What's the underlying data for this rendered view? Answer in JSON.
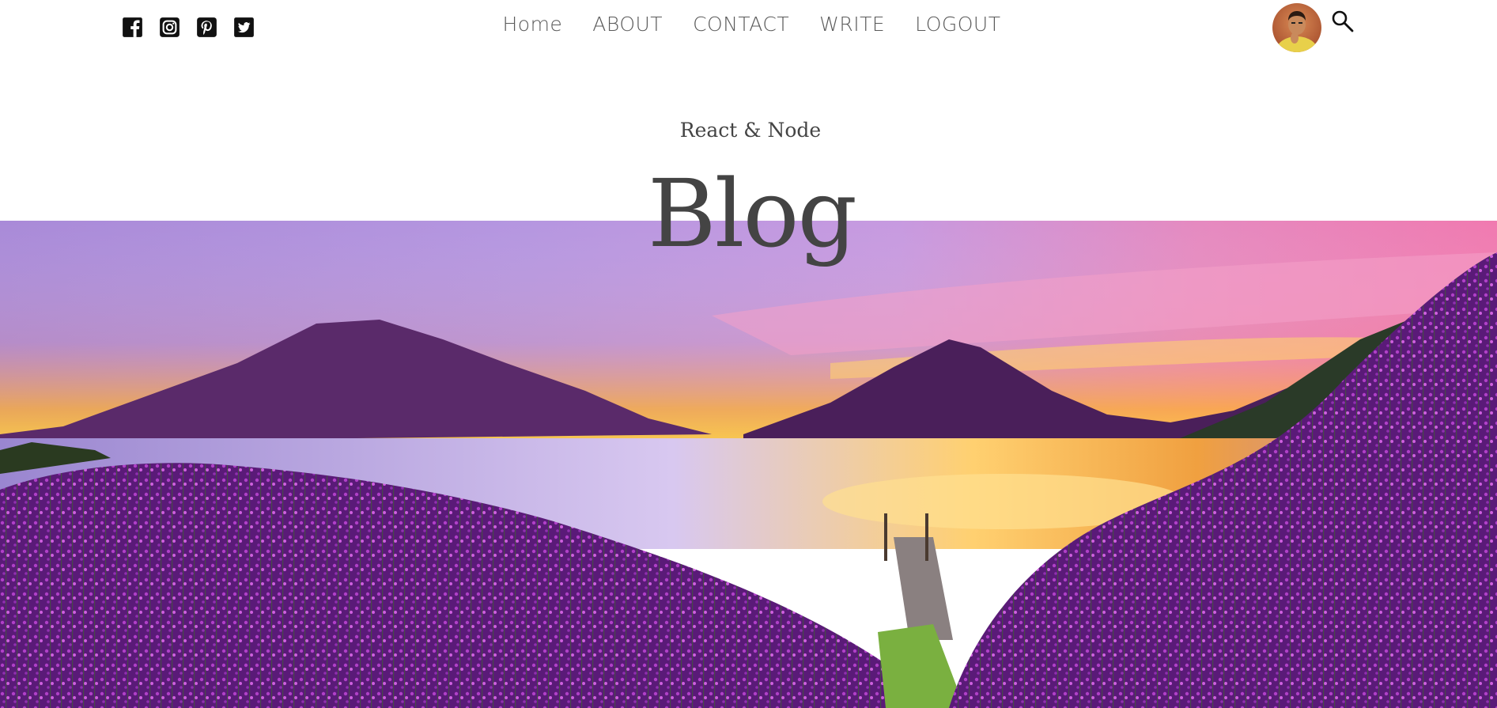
{
  "social": {
    "icons": [
      "facebook-square-icon",
      "instagram-square-icon",
      "pinterest-square-icon",
      "twitter-square-icon"
    ]
  },
  "nav": {
    "items": [
      {
        "label": "Home"
      },
      {
        "label": "ABOUT"
      },
      {
        "label": "CONTACT"
      },
      {
        "label": "WRITE"
      },
      {
        "label": "LOGOUT"
      }
    ]
  },
  "header": {
    "subtitle": "React & Node",
    "title": "Blog"
  },
  "colors": {
    "text": "#444444",
    "nav_text": "#5a5a5a",
    "icon": "#111111"
  }
}
